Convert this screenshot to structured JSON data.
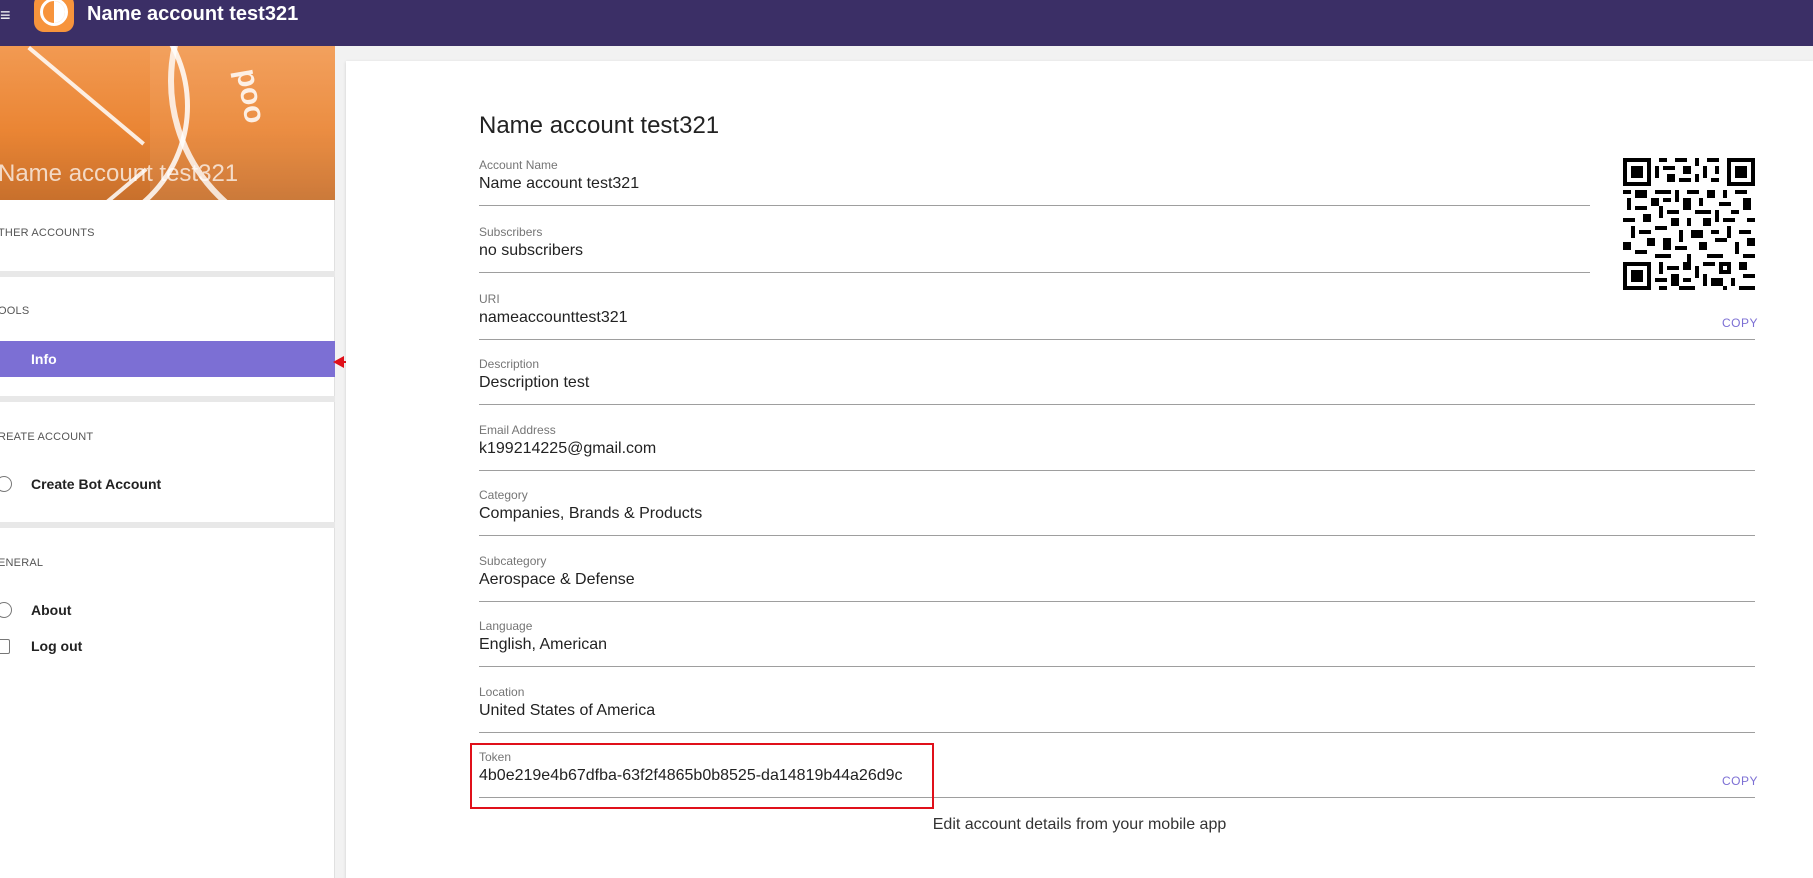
{
  "topbar": {
    "title": "Name account test321",
    "menu_icon": "≡"
  },
  "sidebar": {
    "banner_name": "Name account test321",
    "banner_logo_text": "poo",
    "sections": {
      "other_accounts": "THER ACCOUNTS",
      "tools": "OOLS",
      "create_account": "REATE ACCOUNT",
      "general": "ENERAL"
    },
    "items": {
      "info": "Info",
      "create_bot": "Create Bot Account",
      "about": "About",
      "logout": "Log out"
    }
  },
  "main": {
    "title": "Name account test321",
    "fields": {
      "account_name": {
        "label": "Account Name",
        "value": "Name account test321"
      },
      "subscribers": {
        "label": "Subscribers",
        "value": "no subscribers"
      },
      "uri": {
        "label": "URI",
        "value": "nameaccounttest321"
      },
      "description": {
        "label": "Description",
        "value": "Description test"
      },
      "email": {
        "label": "Email Address",
        "value": "k199214225@gmail.com"
      },
      "category": {
        "label": "Category",
        "value": "Companies, Brands & Products"
      },
      "subcategory": {
        "label": "Subcategory",
        "value": "Aerospace & Defense"
      },
      "language": {
        "label": "Language",
        "value": "English, American"
      },
      "location": {
        "label": "Location",
        "value": "United States of America"
      },
      "token": {
        "label": "Token",
        "value": "4b0e219e4b67dfba-63f2f4865b0b8525-da14819b44a26d9c"
      }
    },
    "copy_label": "COPY",
    "footer_note": "Edit account details from your mobile app"
  },
  "colors": {
    "topbar": "#3b2f66",
    "accent": "#7c6fd4",
    "annotation": "#e0101a",
    "banner": "#ea8534"
  }
}
